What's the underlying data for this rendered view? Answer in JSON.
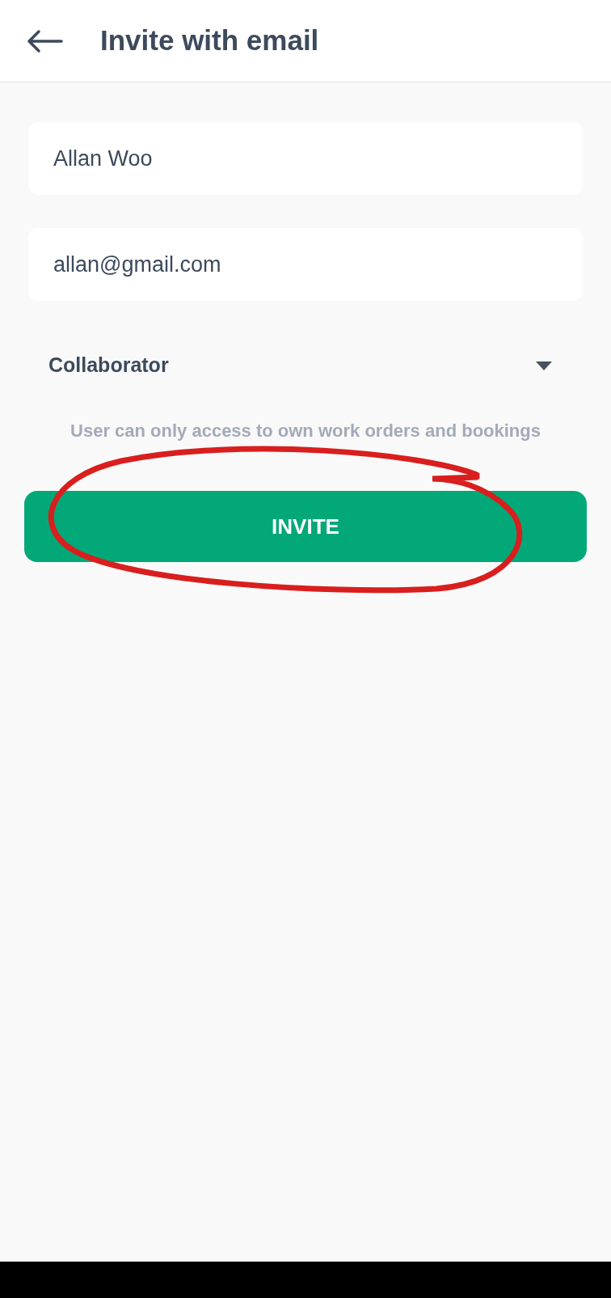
{
  "header": {
    "title": "Invite with email"
  },
  "name_field": {
    "value": "Allan Woo"
  },
  "email_field": {
    "value": "allan@gmail.com"
  },
  "role_dropdown": {
    "value": "Collaborator"
  },
  "helper_text": "User can only access to own work orders and bookings",
  "invite_button": {
    "label": "INVITE"
  }
}
